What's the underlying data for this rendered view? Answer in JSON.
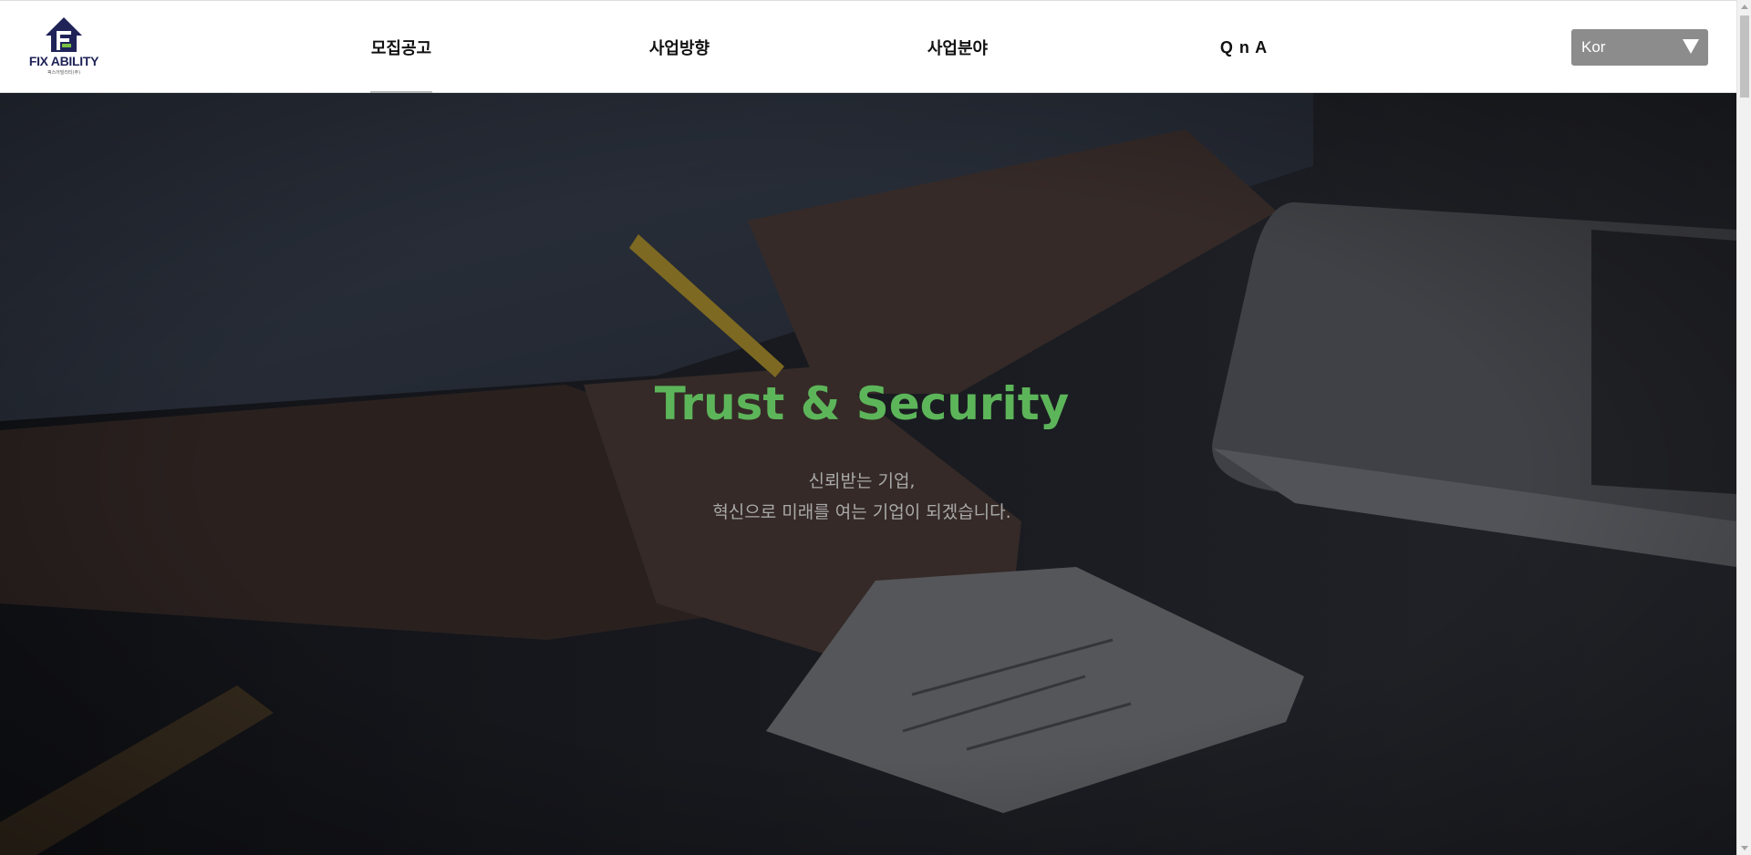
{
  "brand": {
    "name": "FIX ABILITY",
    "tagline": "픽스어빌리티(주)",
    "colors": {
      "navy": "#1f2358",
      "green": "#7ac142"
    }
  },
  "nav": {
    "items": [
      {
        "label": "모집공고",
        "active": true
      },
      {
        "label": "사업방향",
        "active": false
      },
      {
        "label": "사업분야",
        "active": false
      },
      {
        "label": "Q n A",
        "active": false
      }
    ],
    "active_underline_color": "#b8b8b8"
  },
  "language": {
    "selected": "Kor",
    "icon": "triangle-down-icon"
  },
  "hero": {
    "title": "Trust & Security",
    "line1": "신뢰받는 기업,",
    "line2": "혁신으로 미래를 여는 기업이 되겠습니다.",
    "title_color": "#5db55a",
    "text_color": "#a9a9a9"
  }
}
